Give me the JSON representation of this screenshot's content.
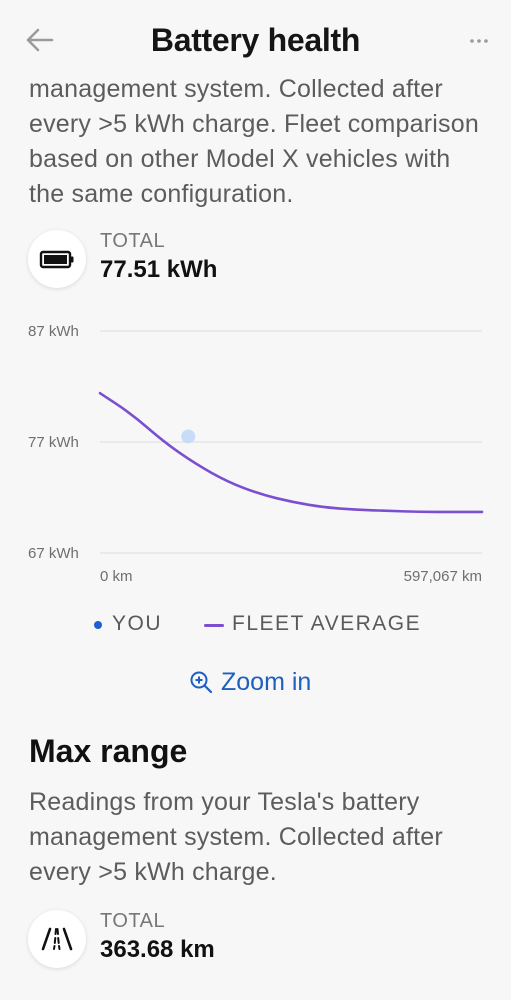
{
  "header": {
    "title": "Battery health",
    "back_icon": "arrow-left-icon",
    "more_icon": "more-horizontal-icon"
  },
  "battery_section": {
    "description_fragment": "management system. Collected after every >5 kWh charge. Fleet comparison based on other Model X vehicles with the same configuration.",
    "stat_label": "TOTAL",
    "stat_value": "77.51 kWh",
    "stat_icon": "battery-icon"
  },
  "chart_data": {
    "type": "line",
    "y_ticks": [
      "87 kWh",
      "77 kWh",
      "67 kWh"
    ],
    "ylim": [
      67,
      87
    ],
    "x_ticks": [
      "0 km",
      "597,067 km"
    ],
    "xlim": [
      0,
      597067
    ],
    "grid": true,
    "series": [
      {
        "name": "FLEET AVERAGE",
        "color": "#7b4fd0",
        "x": [
          0,
          50000,
          100000,
          150000,
          200000,
          250000,
          300000,
          350000,
          400000,
          450000,
          500000,
          550000,
          597067
        ],
        "y": [
          81.4,
          79.5,
          77.0,
          75.0,
          73.4,
          72.3,
          71.6,
          71.1,
          70.9,
          70.8,
          70.7,
          70.7,
          70.7
        ]
      },
      {
        "name": "YOU",
        "color": "#c9dcf7",
        "x": [
          138000
        ],
        "y": [
          77.5
        ]
      }
    ],
    "legend": [
      {
        "label": "YOU",
        "marker": "dot",
        "color": "#1f5fd1"
      },
      {
        "label": "FLEET AVERAGE",
        "marker": "line",
        "color": "#7b4fd0"
      }
    ]
  },
  "zoom": {
    "label": "Zoom in",
    "icon": "zoom-in-icon",
    "color": "#1f5fbf"
  },
  "range_section": {
    "title": "Max range",
    "description": "Readings from your Tesla's battery management system. Collected after every >5 kWh charge.",
    "stat_label": "TOTAL",
    "stat_value": "363.68 km",
    "stat_icon": "road-icon"
  }
}
